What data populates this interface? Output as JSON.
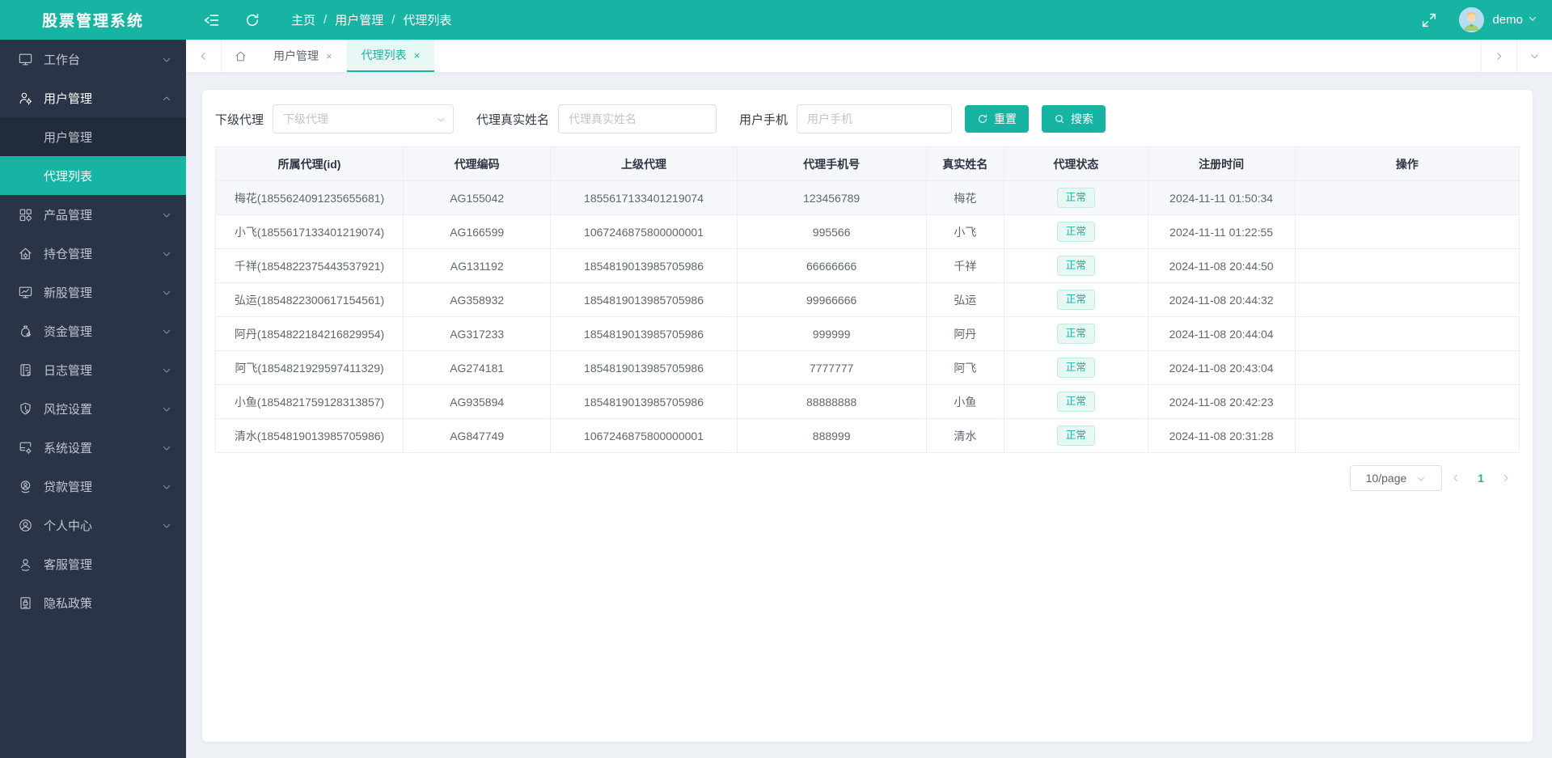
{
  "app": {
    "title": "股票管理系统"
  },
  "colors": {
    "primary": "#17b3a3",
    "sidebar_bg": "#2a3446",
    "badge_bg": "#e7f7f3",
    "badge_text": "#17b3a3"
  },
  "header": {
    "breadcrumb": [
      "主页",
      "用户管理",
      "代理列表"
    ],
    "icons": [
      "collapse-sidebar-icon",
      "refresh-icon",
      "fullscreen-icon",
      "avatar",
      "chevron-down-icon"
    ],
    "user": "demo"
  },
  "sidebar": {
    "items": [
      {
        "label": "工作台",
        "icon": "monitor-icon",
        "chevron": true
      },
      {
        "label": "用户管理",
        "icon": "user-settings-icon",
        "chevron": true,
        "expanded": true,
        "children": [
          {
            "label": "用户管理",
            "active": false
          },
          {
            "label": "代理列表",
            "active": true
          }
        ]
      },
      {
        "label": "产品管理",
        "icon": "grid-icon",
        "chevron": true
      },
      {
        "label": "持仓管理",
        "icon": "home-gear-icon",
        "chevron": true
      },
      {
        "label": "新股管理",
        "icon": "chart-monitor-icon",
        "chevron": true
      },
      {
        "label": "资金管理",
        "icon": "money-bag-icon",
        "chevron": true
      },
      {
        "label": "日志管理",
        "icon": "journal-icon",
        "chevron": true
      },
      {
        "label": "风控设置",
        "icon": "shield-icon",
        "chevron": true
      },
      {
        "label": "系统设置",
        "icon": "system-gear-icon",
        "chevron": true
      },
      {
        "label": "贷款管理",
        "icon": "loan-icon",
        "chevron": true
      },
      {
        "label": "个人中心",
        "icon": "user-circle-icon",
        "chevron": true
      },
      {
        "label": "客服管理",
        "icon": "support-icon",
        "chevron": false
      },
      {
        "label": "隐私政策",
        "icon": "privacy-icon",
        "chevron": false
      }
    ]
  },
  "tabs": {
    "items": [
      {
        "label": "用户管理",
        "close": "×",
        "active": false
      },
      {
        "label": "代理列表",
        "close": "×",
        "active": true
      }
    ]
  },
  "filters": {
    "fields": [
      {
        "label": "下级代理",
        "placeholder": "下级代理",
        "type": "select",
        "value": ""
      },
      {
        "label": "代理真实姓名",
        "placeholder": "代理真实姓名",
        "type": "text",
        "value": ""
      },
      {
        "label": "用户手机",
        "placeholder": "用户手机",
        "type": "text",
        "value": ""
      }
    ],
    "reset_label": "重置",
    "search_label": "搜索"
  },
  "table": {
    "columns": [
      "所属代理(id)",
      "代理编码",
      "上级代理",
      "代理手机号",
      "真实姓名",
      "代理状态",
      "注册时间",
      "操作"
    ],
    "rows": [
      {
        "owner": "梅花(1855624091235655681)",
        "code": "AG155042",
        "parent": "1855617133401219074",
        "phone": "123456789",
        "name": "梅花",
        "status": "正常",
        "time": "2024-11-11 01:50:34"
      },
      {
        "owner": "小飞(1855617133401219074)",
        "code": "AG166599",
        "parent": "1067246875800000001",
        "phone": "995566",
        "name": "小飞",
        "status": "正常",
        "time": "2024-11-11 01:22:55"
      },
      {
        "owner": "千祥(1854822375443537921)",
        "code": "AG131192",
        "parent": "1854819013985705986",
        "phone": "66666666",
        "name": "千祥",
        "status": "正常",
        "time": "2024-11-08 20:44:50"
      },
      {
        "owner": "弘运(1854822300617154561)",
        "code": "AG358932",
        "parent": "1854819013985705986",
        "phone": "99966666",
        "name": "弘运",
        "status": "正常",
        "time": "2024-11-08 20:44:32"
      },
      {
        "owner": "阿丹(1854822184216829954)",
        "code": "AG317233",
        "parent": "1854819013985705986",
        "phone": "999999",
        "name": "阿丹",
        "status": "正常",
        "time": "2024-11-08 20:44:04"
      },
      {
        "owner": "阿飞(1854821929597411329)",
        "code": "AG274181",
        "parent": "1854819013985705986",
        "phone": "7777777",
        "name": "阿飞",
        "status": "正常",
        "time": "2024-11-08 20:43:04"
      },
      {
        "owner": "小鱼(1854821759128313857)",
        "code": "AG935894",
        "parent": "1854819013985705986",
        "phone": "88888888",
        "name": "小鱼",
        "status": "正常",
        "time": "2024-11-08 20:42:23"
      },
      {
        "owner": "清水(1854819013985705986)",
        "code": "AG847749",
        "parent": "1067246875800000001",
        "phone": "888999",
        "name": "清水",
        "status": "正常",
        "time": "2024-11-08 20:31:28"
      }
    ]
  },
  "pagination": {
    "size_label": "10/page",
    "current_page": "1"
  }
}
